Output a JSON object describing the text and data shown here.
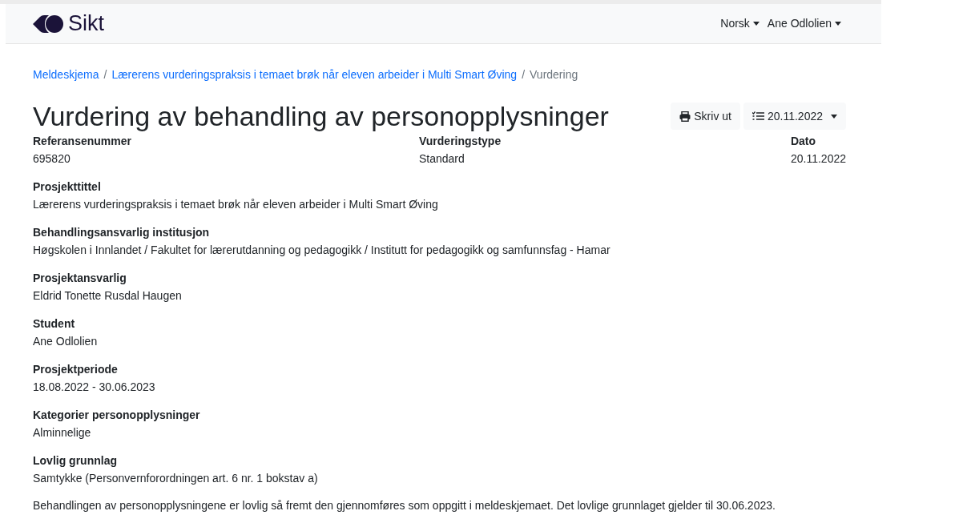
{
  "navbar": {
    "brand": "Sikt",
    "menus": [
      {
        "label": "Norsk"
      },
      {
        "label": "Ane Odlolien"
      }
    ]
  },
  "breadcrumb_separator": "/",
  "breadcrumb": [
    {
      "label": "Meldeskjema",
      "link": true
    },
    {
      "label": "Lærerens vurderingspraksis i temaet brøk når eleven arbeider i Multi Smart Øving",
      "link": true
    },
    {
      "label": "Vurdering",
      "link": false
    }
  ],
  "title": "Vurdering av behandling av personopplysninger",
  "actions": [
    {
      "kind": "print",
      "label": "Skriv ut"
    },
    {
      "kind": "dropdown",
      "label": "20.11.2022"
    }
  ],
  "summary": [
    {
      "label": "Referansenummer",
      "value": "695820"
    },
    {
      "label": "Vurderingstype",
      "value": "Standard"
    },
    {
      "label": "Dato",
      "value": "20.11.2022"
    }
  ],
  "fields": [
    {
      "label": "Prosjekttittel",
      "value": "Lærerens vurderingspraksis i temaet brøk når eleven arbeider i Multi Smart Øving"
    },
    {
      "label": "Behandlingsansvarlig institusjon",
      "value": "Høgskolen i Innlandet / Fakultet for lærerutdanning og pedagogikk / Institutt for pedagogikk og samfunnsfag - Hamar"
    },
    {
      "label": "Prosjektansvarlig",
      "value": "Eldrid Tonette Rusdal Haugen"
    },
    {
      "label": "Student",
      "value": "Ane Odlolien"
    },
    {
      "label": "Prosjektperiode",
      "value": "18.08.2022 - 30.06.2023"
    },
    {
      "label": "Kategorier personopplysninger",
      "value": "Alminnelige"
    },
    {
      "label": "Lovlig grunnlag",
      "value": "Samtykke (Personvernforordningen art. 6 nr. 1 bokstav a)"
    }
  ],
  "paragraph": "Behandlingen av personopplysningene er lovlig så fremt den gjennomføres som oppgitt i meldeskjemaet. Det lovlige grunnlaget gjelder til 30.06.2023."
}
